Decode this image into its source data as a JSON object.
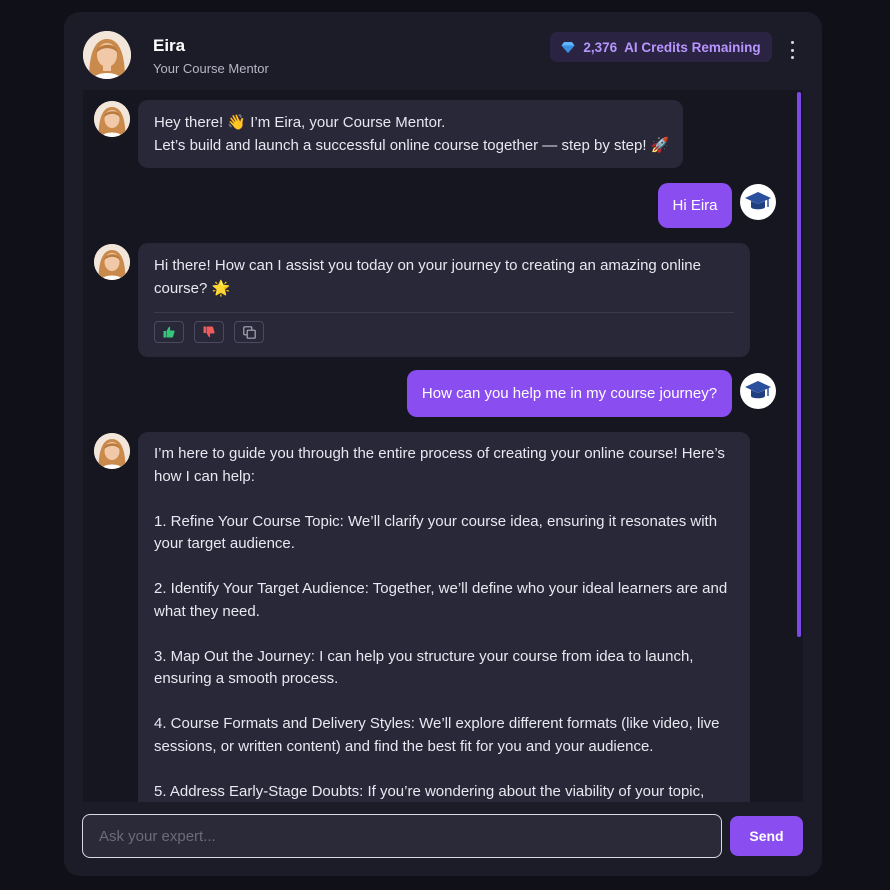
{
  "header": {
    "name": "Eira",
    "subtitle": "Your Course Mentor",
    "credits_label": "2,376  AI Credits Remaining"
  },
  "messages": {
    "m1": {
      "line1": "Hey there! 👋 I’m Eira, your Course Mentor.",
      "line2": "Let’s build and launch a successful online course together — step by step! 🚀"
    },
    "m2": {
      "text": "Hi Eira"
    },
    "m3": {
      "line1": "Hi there! How can I assist you today on your journey to creating an amazing online",
      "line2": "course? 🌟"
    },
    "m4": {
      "text": "How can you help me in my course journey?"
    },
    "m5": {
      "intro1": "I’m here to guide you through the entire process of creating your online course! Here’s",
      "intro2": "how I can help:",
      "p1a": "1. Refine Your Course Topic: We’ll clarify your course idea, ensuring it resonates with",
      "p1b": "your target audience.",
      "p2a": "2. Identify Your Target Audience: Together, we’ll define who your ideal learners are and",
      "p2b": "what they need.",
      "p3a": "3. Map Out the Journey: I can help you structure your course from idea to launch,",
      "p3b": "ensuring a smooth process.",
      "p4a": "4. Course Formats and Delivery Styles: We’ll explore different formats (like video, live",
      "p4b": "sessions, or written content) and find the best fit for you and your audience.",
      "p5a": "5. Address Early-Stage Doubts: If you’re wondering about the viability of your topic,"
    }
  },
  "input": {
    "placeholder": "Ask your expert..."
  },
  "send_label": "Send",
  "colors": {
    "accent": "#8a4df0",
    "credits_text": "#b895ff",
    "thumb_up": "#34c77b",
    "thumb_down": "#ef5b5b"
  }
}
